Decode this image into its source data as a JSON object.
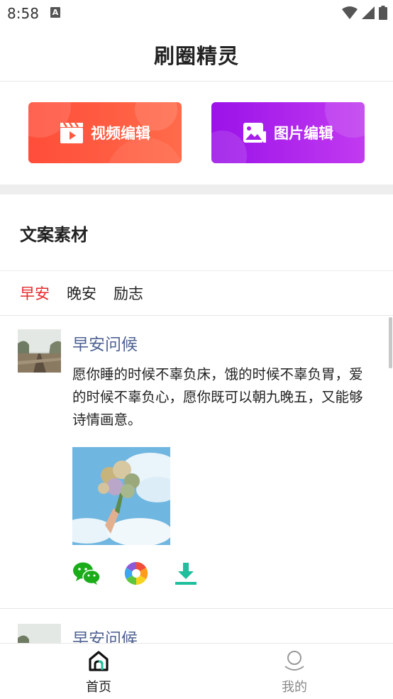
{
  "status_bar": {
    "time": "8:58",
    "notification_letter": "A",
    "icons": [
      "wifi-icon",
      "signal-icon",
      "battery-icon"
    ]
  },
  "header": {
    "title": "刷圈精灵"
  },
  "actions": {
    "video_edit": {
      "label": "视频编辑",
      "icon": "video-clapper-icon",
      "color": "#ff5740"
    },
    "image_edit": {
      "label": "图片编辑",
      "icon": "image-edit-icon",
      "color": "#a61eea"
    }
  },
  "section": {
    "title": "文案素材"
  },
  "tabs": [
    {
      "label": "早安",
      "active": true
    },
    {
      "label": "晚安",
      "active": false
    },
    {
      "label": "励志",
      "active": false
    }
  ],
  "posts": [
    {
      "title": "早安问候",
      "body": "愿你睡的时候不辜负床，饿的时候不辜负胃，爱的时候不辜负心，愿你既可以朝九晚五，又能够诗情画意。",
      "actions": [
        "wechat-icon",
        "moments-icon",
        "download-icon"
      ]
    },
    {
      "title": "早安问候"
    }
  ],
  "bottom_nav": [
    {
      "label": "首页",
      "icon": "home-icon",
      "active": true
    },
    {
      "label": "我的",
      "icon": "profile-icon",
      "active": false
    }
  ],
  "colors": {
    "active_tab": "#e8282a",
    "post_title": "#4f6392",
    "download": "#1fbe9c"
  }
}
